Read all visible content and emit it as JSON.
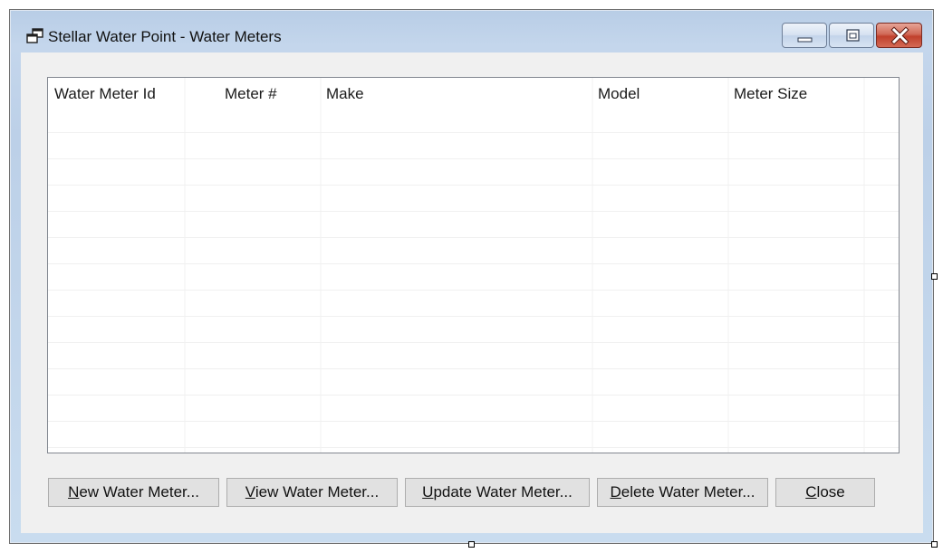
{
  "window": {
    "title": "Stellar Water Point - Water Meters",
    "controls": [
      "minimize-icon",
      "maximize-icon",
      "close-icon"
    ],
    "close_color": "#c8412f"
  },
  "list_view": {
    "columns": [
      "Water Meter Id",
      "Meter #",
      "Make",
      "Model",
      "Meter Size"
    ],
    "rows": []
  },
  "buttons": {
    "new": {
      "mnemonic": "N",
      "rest": "ew Water Meter..."
    },
    "view": {
      "mnemonic": "V",
      "rest": "iew Water Meter..."
    },
    "update": {
      "mnemonic": "U",
      "rest": "pdate Water Meter..."
    },
    "delete": {
      "mnemonic": "D",
      "rest": "elete Water Meter..."
    },
    "close": {
      "mnemonic": "C",
      "rest": "lose"
    }
  }
}
